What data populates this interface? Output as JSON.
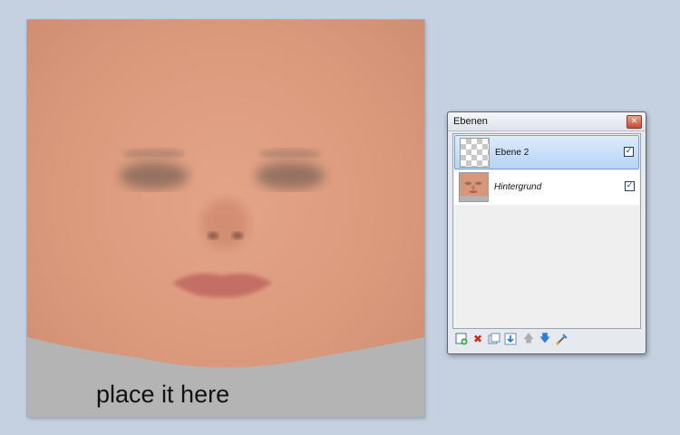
{
  "canvas": {
    "caption": "place it here"
  },
  "layers_panel": {
    "title": "Ebenen",
    "layers": [
      {
        "name": "Ebene 2",
        "visible": true,
        "selected": true,
        "thumbnail": "transparent-checker"
      },
      {
        "name": "Hintergrund",
        "visible": true,
        "selected": false,
        "thumbnail": "face-texture"
      }
    ],
    "toolbar_icons": [
      "add-layer-icon",
      "delete-layer-icon",
      "duplicate-layer-icon",
      "merge-down-icon",
      "move-up-icon",
      "move-down-icon",
      "layer-properties-icon"
    ],
    "check_glyph": "✓"
  },
  "colors": {
    "desktop_bg": "#c5d1e0",
    "skin": "#d9997b",
    "selection_bg": "#b6d4f5",
    "close_button": "#c44c35"
  }
}
